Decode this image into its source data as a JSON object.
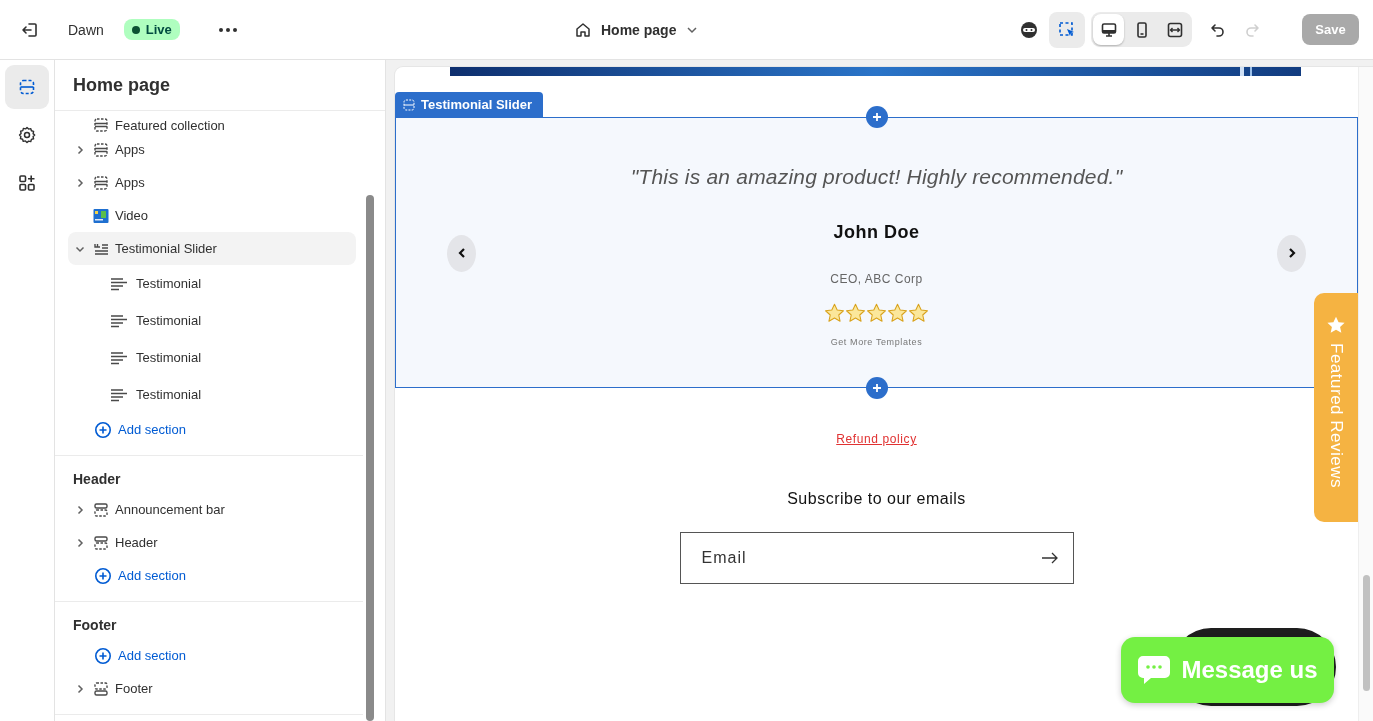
{
  "topbar": {
    "store": "Dawn",
    "status": "Live",
    "page": "Home page",
    "inspect_selected": true,
    "devices": [
      {
        "kind": "desktop",
        "selected": true
      },
      {
        "kind": "mobile",
        "selected": false
      },
      {
        "kind": "fullwidth",
        "selected": false
      }
    ],
    "redo_disabled": true,
    "save": {
      "label": "Save",
      "disabled": true
    }
  },
  "rail": [
    {
      "kind": "sections",
      "selected": true
    },
    {
      "kind": "settings",
      "selected": false
    },
    {
      "kind": "apps",
      "selected": false
    }
  ],
  "sidebar": {
    "title": "Home page",
    "groups": [
      {
        "items": [
          {
            "kind": "section",
            "label": "Featured collection",
            "selected": false
          },
          {
            "kind": "section",
            "label": "Apps",
            "expanded": false,
            "selected": false
          },
          {
            "kind": "section",
            "label": "Apps",
            "expanded": false,
            "selected": false
          },
          {
            "kind": "video",
            "label": "Video",
            "selected": false
          },
          {
            "kind": "slider",
            "label": "Testimonial Slider",
            "expanded": true,
            "selected": true,
            "children": [
              {
                "label": "Testimonial",
                "selected": false
              },
              {
                "label": "Testimonial",
                "selected": false
              },
              {
                "label": "Testimonial",
                "selected": false
              },
              {
                "label": "Testimonial",
                "selected": false
              }
            ]
          },
          {
            "kind": "add",
            "label": "Add section"
          }
        ]
      },
      {
        "title": "Header",
        "items": [
          {
            "kind": "header",
            "label": "Announcement bar",
            "expanded": false,
            "selected": false
          },
          {
            "kind": "header",
            "label": "Header",
            "expanded": false,
            "selected": false
          },
          {
            "kind": "add",
            "label": "Add section"
          }
        ]
      },
      {
        "title": "Footer",
        "items": [
          {
            "kind": "add",
            "label": "Add section"
          },
          {
            "kind": "footer",
            "label": "Footer",
            "expanded": false,
            "selected": false
          }
        ]
      }
    ]
  },
  "preview": {
    "section_tag": "Testimonial Slider",
    "testimonial": {
      "quote": "\"This is an amazing product! Highly recommended.\"",
      "name": "John Doe",
      "role": "CEO, ABC Corp",
      "stars": 5,
      "credit": "Get More Templates"
    },
    "refund_link": "Refund policy",
    "subscribe_title": "Subscribe to our emails",
    "email": {
      "placeholder": "Email"
    },
    "reviews_tab": "Featured Reviews",
    "chat_button": "Message us"
  }
}
